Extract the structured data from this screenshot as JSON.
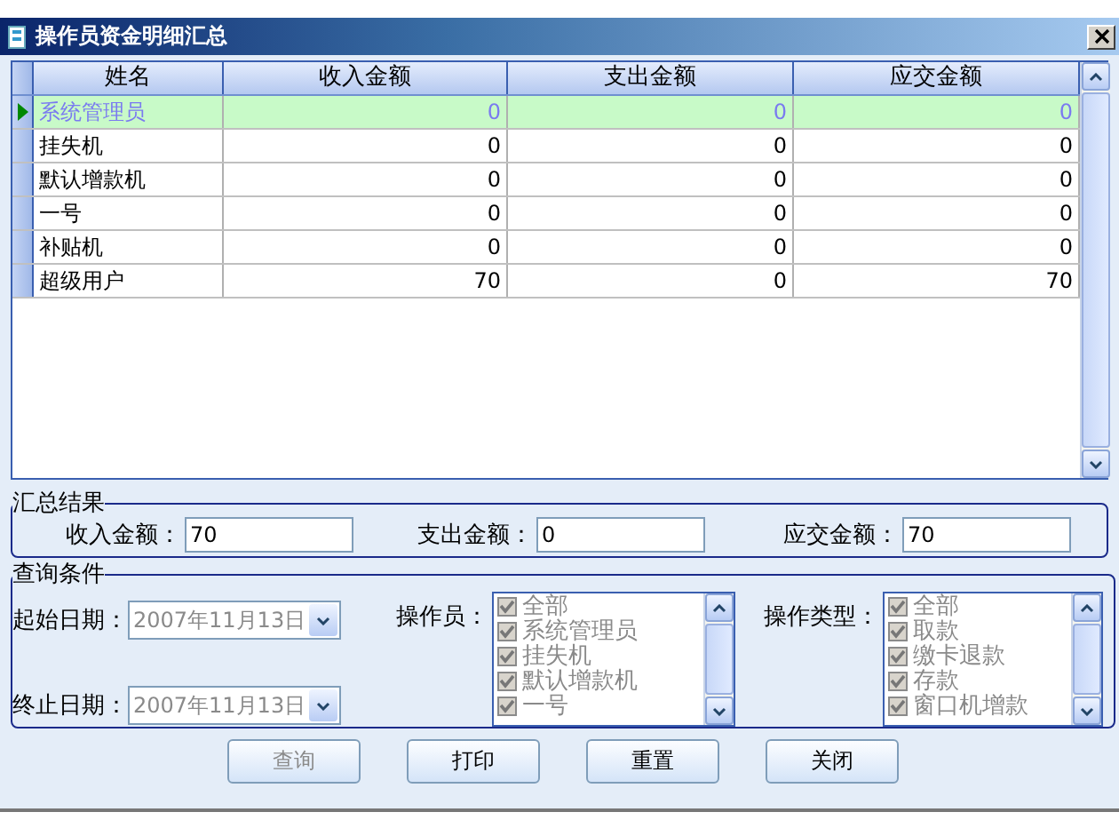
{
  "window": {
    "title": "操作员资金明细汇总"
  },
  "table": {
    "columns": [
      "姓名",
      "收入金额",
      "支出金额",
      "应交金额"
    ],
    "rows": [
      {
        "cells": [
          "系统管理员",
          "0",
          "0",
          "0"
        ],
        "selected": true
      },
      {
        "cells": [
          "挂失机",
          "0",
          "0",
          "0"
        ],
        "selected": false
      },
      {
        "cells": [
          "默认增款机",
          "0",
          "0",
          "0"
        ],
        "selected": false
      },
      {
        "cells": [
          "一号",
          "0",
          "0",
          "0"
        ],
        "selected": false
      },
      {
        "cells": [
          "补贴机",
          "0",
          "0",
          "0"
        ],
        "selected": false
      },
      {
        "cells": [
          "超级用户",
          "70",
          "0",
          "70"
        ],
        "selected": false
      }
    ]
  },
  "summary": {
    "title": "汇总结果",
    "fields": [
      {
        "label": "收入金额：",
        "value": "70"
      },
      {
        "label": "支出金额：",
        "value": "0"
      },
      {
        "label": "应交金额：",
        "value": "70"
      }
    ]
  },
  "query": {
    "title": "查询条件",
    "dates": [
      {
        "label": "起始日期：",
        "value": "2007年11月13日",
        "disabled": true
      },
      {
        "label": "终止日期：",
        "value": "2007年11月13日",
        "disabled": true
      }
    ],
    "lists": [
      {
        "label": "操作员：",
        "disabled": true,
        "items": [
          {
            "label": "全部",
            "checked": true
          },
          {
            "label": "系统管理员",
            "checked": true
          },
          {
            "label": "挂失机",
            "checked": true
          },
          {
            "label": "默认增款机",
            "checked": true
          },
          {
            "label": "一号",
            "checked": true
          }
        ]
      },
      {
        "label": "操作类型：",
        "disabled": true,
        "items": [
          {
            "label": "全部",
            "checked": true
          },
          {
            "label": "取款",
            "checked": true
          },
          {
            "label": "缴卡退款",
            "checked": true
          },
          {
            "label": "存款",
            "checked": true
          },
          {
            "label": "窗口机增款",
            "checked": true
          }
        ]
      }
    ]
  },
  "buttons": [
    {
      "label": "查询",
      "disabled": true
    },
    {
      "label": "打印",
      "disabled": false
    },
    {
      "label": "重置",
      "disabled": false
    },
    {
      "label": "关闭",
      "disabled": false
    }
  ]
}
